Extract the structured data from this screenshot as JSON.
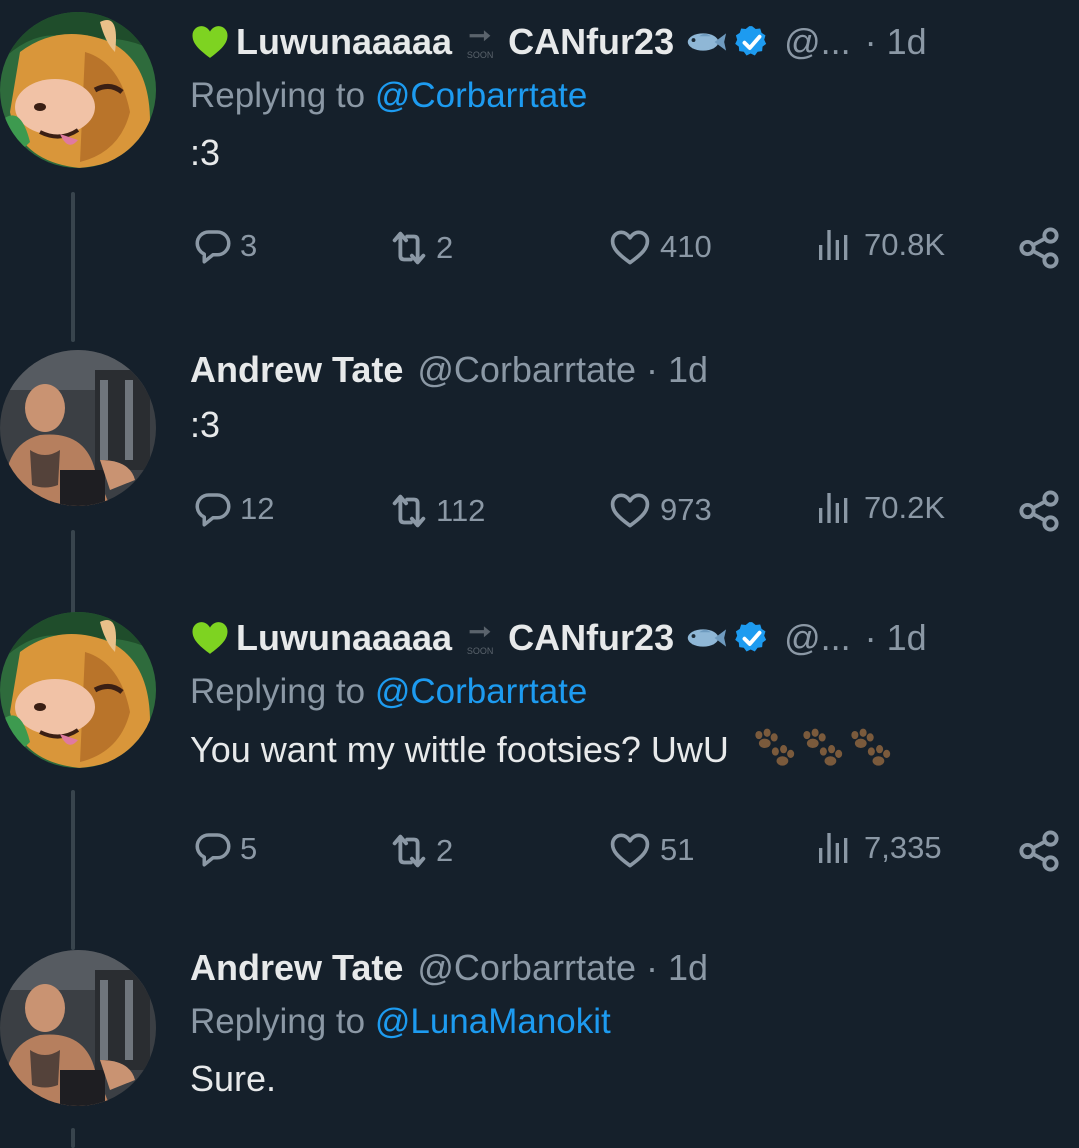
{
  "tweets": [
    {
      "display_name": "Luwunaaaaa",
      "arrow_label": "SOON",
      "display_name_2": "CANfur23",
      "handle": "@...",
      "time": "· 1d",
      "reply_prefix": "Replying to ",
      "reply_to": "@Corbarrtate",
      "text": ":3",
      "stats": {
        "replies": "3",
        "retweets": "2",
        "likes": "410",
        "views": "70.8K"
      }
    },
    {
      "display_name": "Andrew Tate",
      "handle": "@Corbarrtate",
      "time": "· 1d",
      "text": ":3",
      "stats": {
        "replies": "12",
        "retweets": "112",
        "likes": "973",
        "views": "70.2K"
      }
    },
    {
      "display_name": "Luwunaaaaa",
      "arrow_label": "SOON",
      "display_name_2": "CANfur23",
      "handle": "@...",
      "time": "· 1d",
      "reply_prefix": "Replying to ",
      "reply_to": "@Corbarrtate",
      "text": "You want my wittle footsies? UwU",
      "stats": {
        "replies": "5",
        "retweets": "2",
        "likes": "51",
        "views": "7,335"
      }
    },
    {
      "display_name": "Andrew Tate",
      "handle": "@Corbarrtate",
      "time": "· 1d",
      "reply_prefix": "Replying to ",
      "reply_to": "@LunaManokit",
      "text": "Sure."
    }
  ],
  "colors": {
    "background": "#15202b",
    "text": "#e7e9ea",
    "muted": "#8b98a5",
    "link": "#1d9bf0",
    "verified": "#1d9bf0",
    "green_heart": "#7ed321",
    "thread_line": "#38444d"
  },
  "icons": [
    "green-heart-emoji",
    "arrow-soon-emoji",
    "fish-emoji",
    "verified-badge-icon",
    "reply-icon",
    "retweet-icon",
    "like-icon",
    "views-icon",
    "share-icon",
    "paw-prints-emoji"
  ]
}
